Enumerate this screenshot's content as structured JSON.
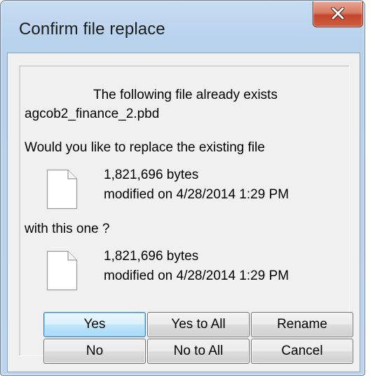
{
  "window": {
    "title": "Confirm file replace"
  },
  "message": {
    "line1": "The following file already exists",
    "filename": "agcob2_finance_2.pbd",
    "question": "Would you like to replace the existing file",
    "with_text": "with this one ?"
  },
  "existing_file": {
    "size": "1,821,696 bytes",
    "modified": "modified on 4/28/2014 1:29 PM"
  },
  "new_file": {
    "size": "1,821,696 bytes",
    "modified": "modified on 4/28/2014 1:29 PM"
  },
  "buttons": {
    "yes": "Yes",
    "yes_to_all": "Yes to All",
    "rename": "Rename",
    "no": "No",
    "no_to_all": "No to All",
    "cancel": "Cancel"
  },
  "colors": {
    "title_bar": "#c6dcf1",
    "close_button": "#c4462c",
    "client_background": "#f0f0f0",
    "default_button_border": "#3c7fb1"
  }
}
